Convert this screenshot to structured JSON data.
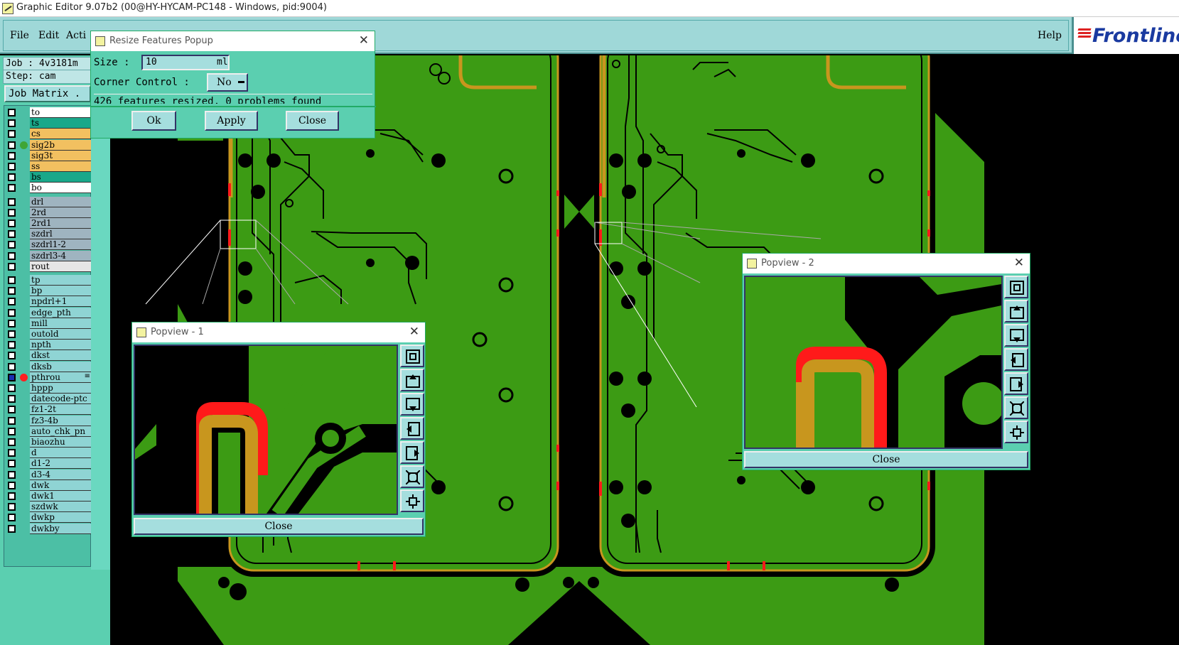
{
  "window": {
    "title": "Graphic Editor 9.07b2 (00@HY-HYCAM-PC148 - Windows, pid:9004)"
  },
  "menu": {
    "file": "File",
    "edit": "Edit",
    "action": "Acti",
    "help": "Help"
  },
  "brand": {
    "name": "Frontline"
  },
  "job": {
    "job_line": "Job : 4v3181m",
    "step_line": "Step: cam",
    "matrix_button": "Job Matrix ."
  },
  "layers": [
    {
      "name": "to",
      "color": "#ffffff"
    },
    {
      "name": "ts",
      "color": "#1aa88a"
    },
    {
      "name": "cs",
      "color": "#f2c060"
    },
    {
      "name": "sig2b",
      "color": "#f2c060",
      "active_dot": "#3fa535"
    },
    {
      "name": "sig3t",
      "color": "#f2c060"
    },
    {
      "name": "ss",
      "color": "#f2c060"
    },
    {
      "name": "bs",
      "color": "#1aa88a"
    },
    {
      "name": "bo",
      "color": "#ffffff"
    },
    {
      "name": "drl",
      "color": "#9fb4c0"
    },
    {
      "name": "2rd",
      "color": "#9fb4c0"
    },
    {
      "name": "2rd1",
      "color": "#9fb4c0"
    },
    {
      "name": "szdrl",
      "color": "#9fb4c0"
    },
    {
      "name": "szdrl1-2",
      "color": "#9fb4c0"
    },
    {
      "name": "szdrl3-4",
      "color": "#9fb4c0"
    },
    {
      "name": "rout",
      "color": "#e6e6e6"
    },
    {
      "name": "tp",
      "color": "#8fd4d4"
    },
    {
      "name": "bp",
      "color": "#8fd4d4"
    },
    {
      "name": "npdrl+1",
      "color": "#8fd4d4"
    },
    {
      "name": "edge_pth",
      "color": "#8fd4d4"
    },
    {
      "name": "mill",
      "color": "#8fd4d4"
    },
    {
      "name": "outold",
      "color": "#8fd4d4"
    },
    {
      "name": "npth",
      "color": "#8fd4d4"
    },
    {
      "name": "dkst",
      "color": "#8fd4d4"
    },
    {
      "name": "dksb",
      "color": "#8fd4d4"
    },
    {
      "name": "pthrou",
      "color": "#8fd4d4",
      "active_dot": "#ff2020",
      "selected": true,
      "marker": "≡"
    },
    {
      "name": "hppp",
      "color": "#8fd4d4"
    },
    {
      "name": "datecode-ptc",
      "color": "#8fd4d4"
    },
    {
      "name": "fz1-2t",
      "color": "#8fd4d4"
    },
    {
      "name": "fz3-4b",
      "color": "#8fd4d4"
    },
    {
      "name": "auto_chk_pn",
      "color": "#8fd4d4"
    },
    {
      "name": "biaozhu",
      "color": "#8fd4d4"
    },
    {
      "name": "d",
      "color": "#8fd4d4"
    },
    {
      "name": "d1-2",
      "color": "#8fd4d4"
    },
    {
      "name": "d3-4",
      "color": "#8fd4d4"
    },
    {
      "name": "dwk",
      "color": "#8fd4d4"
    },
    {
      "name": "dwk1",
      "color": "#8fd4d4"
    },
    {
      "name": "szdwk",
      "color": "#8fd4d4"
    },
    {
      "name": "dwkp",
      "color": "#8fd4d4"
    },
    {
      "name": "dwkby",
      "color": "#8fd4d4"
    }
  ],
  "resize_popup": {
    "title": "Resize Features Popup",
    "size_label": "Size :",
    "size_value": "10",
    "size_unit": "ml",
    "corner_label": "Corner Control :",
    "corner_value": "No",
    "status": "426 features resized, 0 problems found",
    "ok": "Ok",
    "apply": "Apply",
    "close": "Close"
  },
  "popview1": {
    "title": "Popview - 1",
    "close": "Close"
  },
  "popview2": {
    "title": "Popview - 2",
    "close": "Close"
  },
  "colors": {
    "board": "#3c9b14",
    "copper_outline": "#c8961e",
    "highlight": "#ff1a1a",
    "panel": "#5bcfb0",
    "button": "#a5dede"
  }
}
